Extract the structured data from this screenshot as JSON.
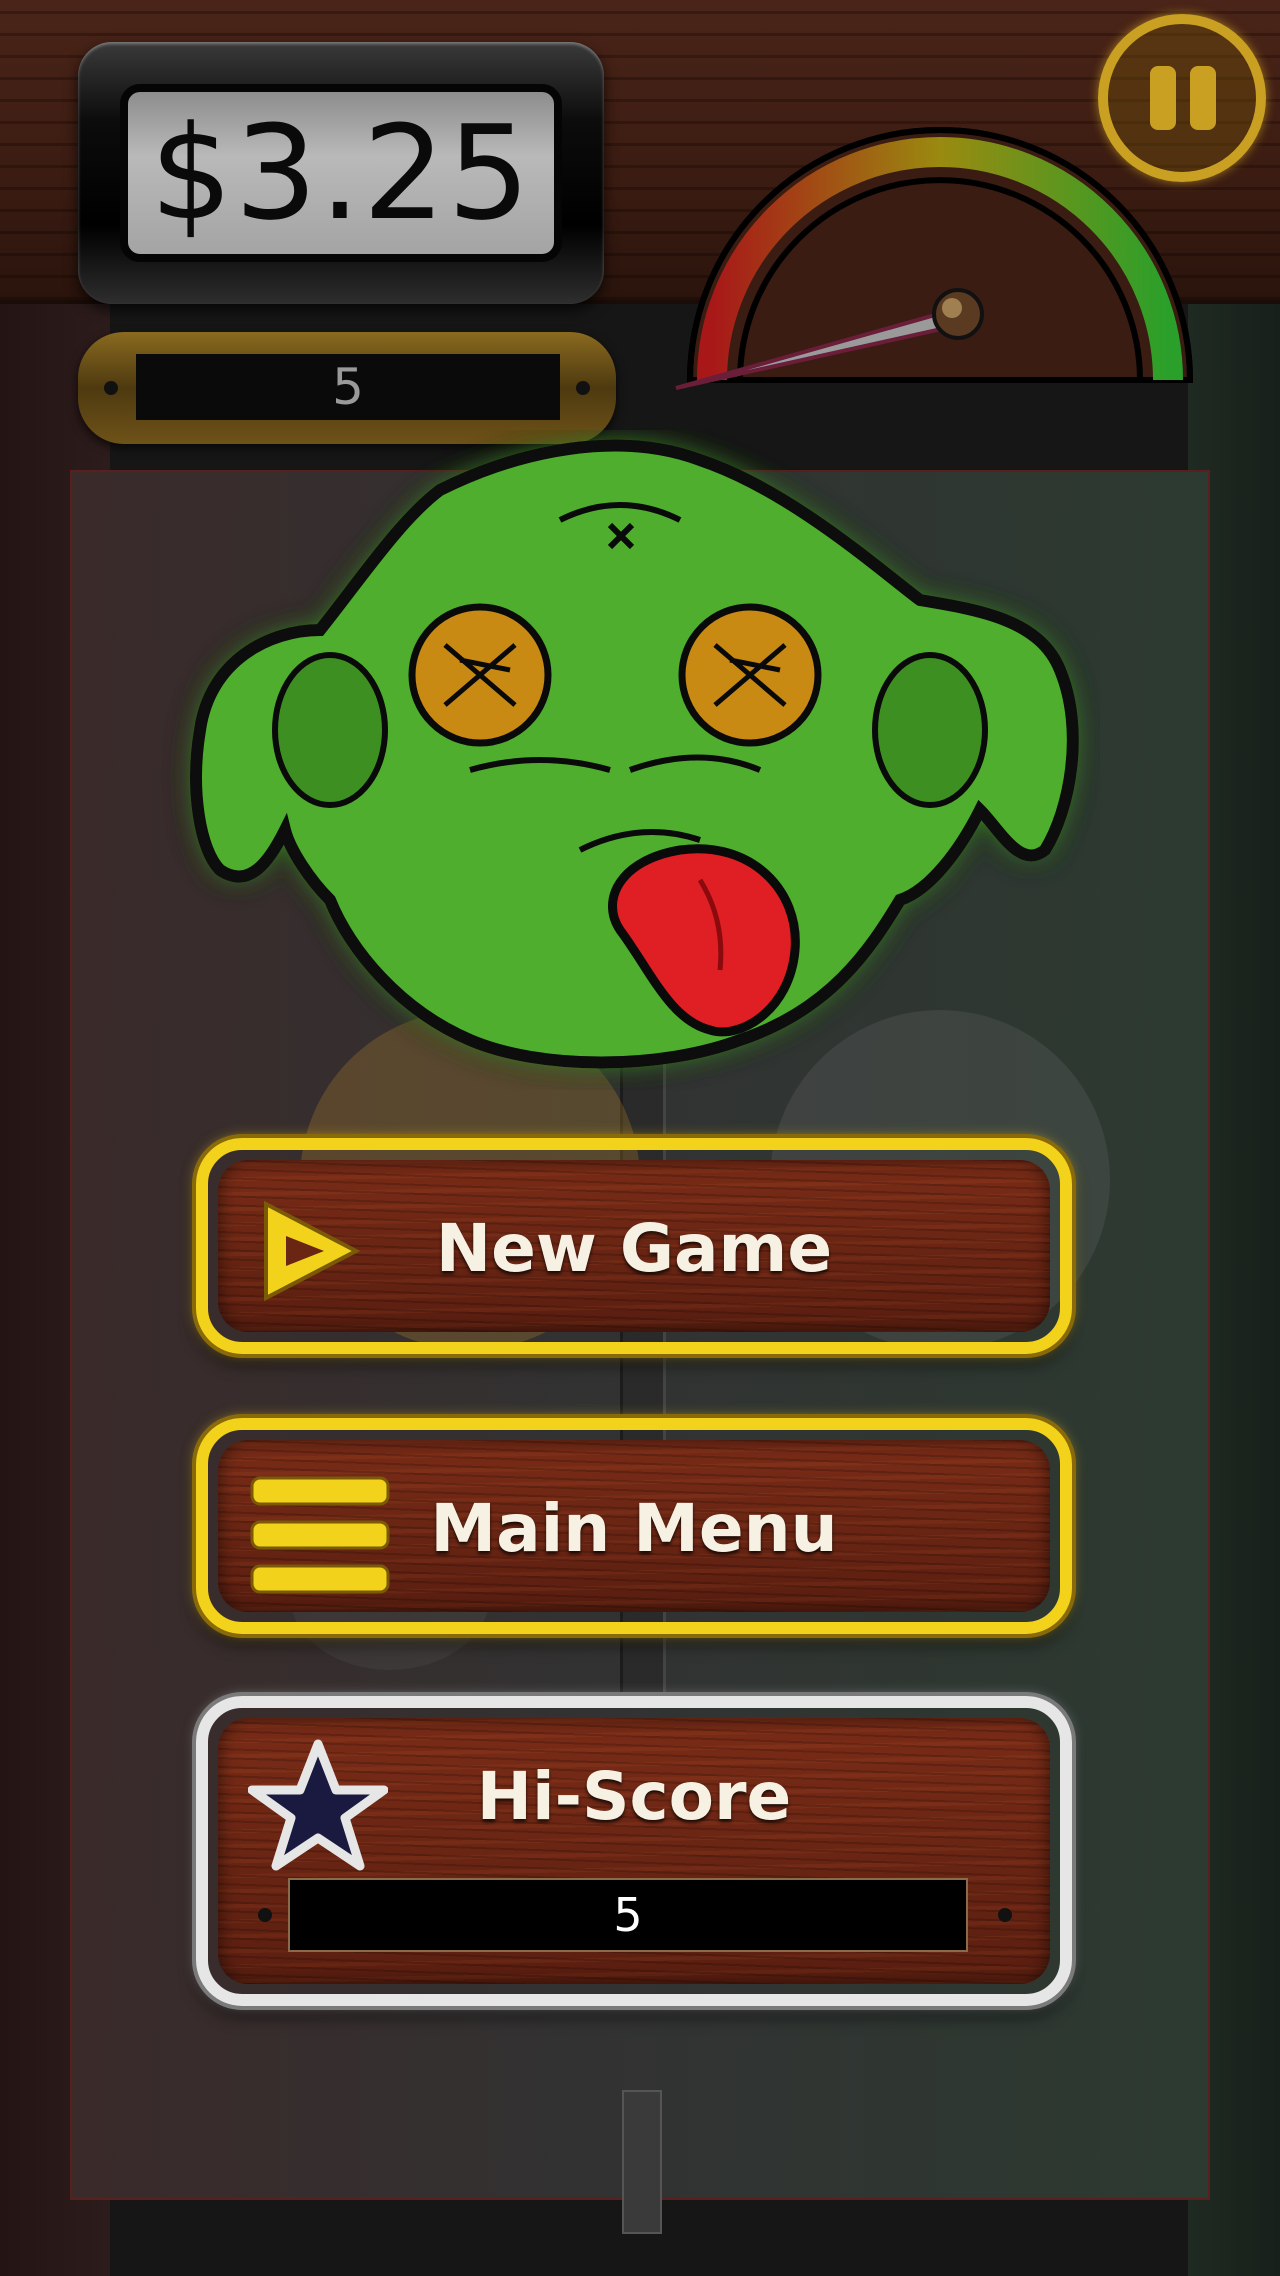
{
  "hud": {
    "money": "$3.25",
    "counter": "5",
    "pause_icon": "pause-icon",
    "meter_icon": "speed-gauge-icon",
    "meter_level": 0.15
  },
  "menu": {
    "new_game_label": "New Game",
    "new_game_icon": "play-triangle-icon",
    "main_menu_label": "Main Menu",
    "main_menu_icon": "menu-bars-icon",
    "hiscore_label": "Hi-Score",
    "hiscore_icon": "star-icon",
    "hiscore_value": "5"
  },
  "character": {
    "icon": "dead-goblin-face-icon"
  },
  "colors": {
    "gold": "#f2d21a",
    "silver": "#e6e6e6",
    "wood": "#6a2513",
    "goblin_green": "#4fae2e",
    "tongue_red": "#e01f24"
  }
}
